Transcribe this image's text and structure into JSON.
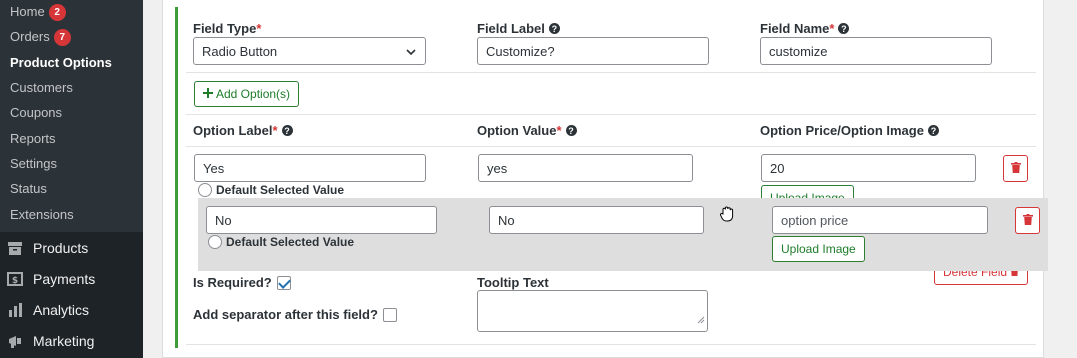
{
  "sidebar": {
    "submenu": [
      {
        "label": "Home",
        "badge": "2"
      },
      {
        "label": "Orders",
        "badge": "7"
      },
      {
        "label": "Product Options"
      },
      {
        "label": "Customers"
      },
      {
        "label": "Coupons"
      },
      {
        "label": "Reports"
      },
      {
        "label": "Settings"
      },
      {
        "label": "Status"
      },
      {
        "label": "Extensions"
      }
    ],
    "menu": [
      {
        "label": "Products",
        "icon": "archive-icon"
      },
      {
        "label": "Payments",
        "icon": "dollar-icon"
      },
      {
        "label": "Analytics",
        "icon": "bar-chart-icon"
      },
      {
        "label": "Marketing",
        "icon": "megaphone-icon"
      }
    ]
  },
  "field": {
    "type_label": "Field Type",
    "type_value": "Radio Button",
    "label_label": "Field Label",
    "label_value": "Customize?",
    "name_label": "Field Name",
    "name_value": "customize",
    "add_option_label": "Add Option(s)"
  },
  "options_header": {
    "label": "Option Label",
    "value": "Option Value",
    "price": "Option Price/Option Image"
  },
  "options": [
    {
      "label": "Yes",
      "value": "yes",
      "price": "20",
      "default_label": "Default Selected Value",
      "upload_label": "Upload Image"
    },
    {
      "label": "No",
      "value": "No",
      "price_placeholder": "option price",
      "default_label": "Default Selected Value",
      "upload_label": "Upload Image"
    }
  ],
  "footer": {
    "required_label": "Is Required?",
    "required_checked": true,
    "separator_label": "Add separator after this field?",
    "separator_checked": false,
    "tooltip_label": "Tooltip Text",
    "delete_field_label": "Delete Field"
  },
  "colors": {
    "accent_green": "#3f9a3a",
    "danger_red": "#d63638",
    "sidebar_dark": "#1d2327"
  }
}
